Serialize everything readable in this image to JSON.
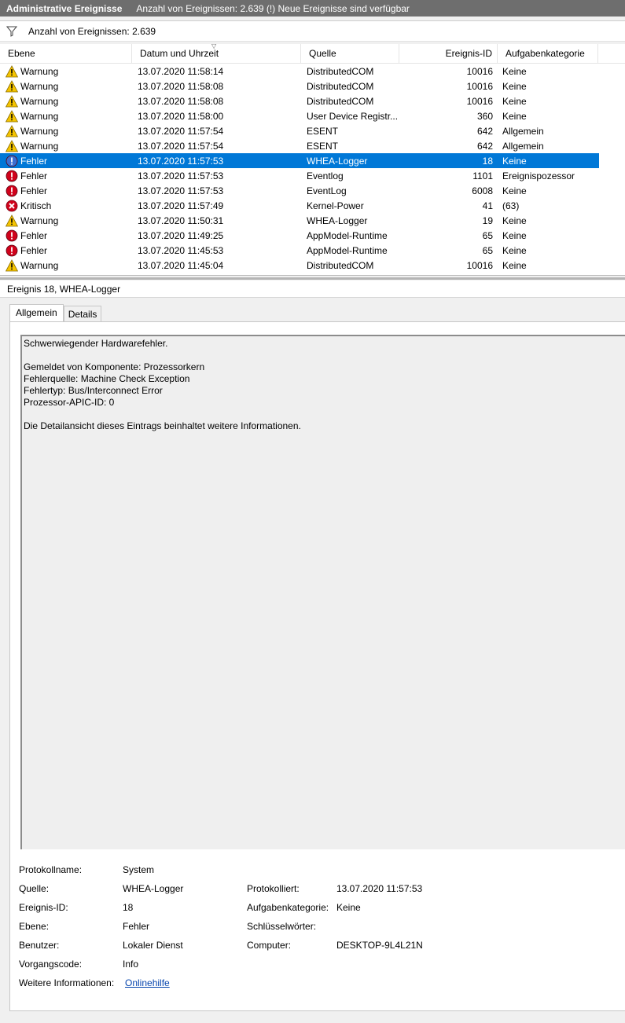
{
  "titlebar": {
    "app": "Administrative Ereignisse",
    "info": "Anzahl von Ereignissen: 2.639 (!) Neue Ereignisse sind verfügbar"
  },
  "filter": {
    "text": "Anzahl von Ereignissen: 2.639",
    "icon": "filter-icon"
  },
  "columns": [
    "Ebene",
    "Datum und Uhrzeit",
    "Quelle",
    "Ereignis-ID",
    "Aufgabenkategorie"
  ],
  "events": [
    {
      "level": "Warnung",
      "icon": "warning",
      "date": "13.07.2020 11:58:14",
      "source": "DistributedCOM",
      "id": "10016",
      "category": "Keine"
    },
    {
      "level": "Warnung",
      "icon": "warning",
      "date": "13.07.2020 11:58:08",
      "source": "DistributedCOM",
      "id": "10016",
      "category": "Keine"
    },
    {
      "level": "Warnung",
      "icon": "warning",
      "date": "13.07.2020 11:58:08",
      "source": "DistributedCOM",
      "id": "10016",
      "category": "Keine"
    },
    {
      "level": "Warnung",
      "icon": "warning",
      "date": "13.07.2020 11:58:00",
      "source": "User Device Registr...",
      "id": "360",
      "category": "Keine"
    },
    {
      "level": "Warnung",
      "icon": "warning",
      "date": "13.07.2020 11:57:54",
      "source": "ESENT",
      "id": "642",
      "category": "Allgemein"
    },
    {
      "level": "Warnung",
      "icon": "warning",
      "date": "13.07.2020 11:57:54",
      "source": "ESENT",
      "id": "642",
      "category": "Allgemein"
    },
    {
      "level": "Fehler",
      "icon": "error",
      "date": "13.07.2020 11:57:53",
      "source": "WHEA-Logger",
      "id": "18",
      "category": "Keine",
      "selected": true
    },
    {
      "level": "Fehler",
      "icon": "error",
      "date": "13.07.2020 11:57:53",
      "source": "Eventlog",
      "id": "1101",
      "category": "Ereignispozessor"
    },
    {
      "level": "Fehler",
      "icon": "error",
      "date": "13.07.2020 11:57:53",
      "source": "EventLog",
      "id": "6008",
      "category": "Keine"
    },
    {
      "level": "Kritisch",
      "icon": "critical",
      "date": "13.07.2020 11:57:49",
      "source": "Kernel-Power",
      "id": "41",
      "category": "(63)"
    },
    {
      "level": "Warnung",
      "icon": "warning",
      "date": "13.07.2020 11:50:31",
      "source": "WHEA-Logger",
      "id": "19",
      "category": "Keine"
    },
    {
      "level": "Fehler",
      "icon": "error",
      "date": "13.07.2020 11:49:25",
      "source": "AppModel-Runtime",
      "id": "65",
      "category": "Keine"
    },
    {
      "level": "Fehler",
      "icon": "error",
      "date": "13.07.2020 11:45:53",
      "source": "AppModel-Runtime",
      "id": "65",
      "category": "Keine"
    },
    {
      "level": "Warnung",
      "icon": "warning",
      "date": "13.07.2020 11:45:04",
      "source": "DistributedCOM",
      "id": "10016",
      "category": "Keine"
    }
  ],
  "detail": {
    "title": "Ereignis 18, WHEA-Logger",
    "tabs": [
      "Allgemein",
      "Details"
    ],
    "message": [
      "Schwerwiegender Hardwarefehler.",
      "",
      "Gemeldet von Komponente: Prozessorkern",
      "Fehlerquelle: Machine Check Exception",
      "Fehlertyp: Bus/Interconnect Error",
      "Prozessor-APIC-ID: 0",
      "",
      "Die Detailansicht dieses Eintrags beinhaltet weitere Informationen."
    ],
    "props": {
      "protokollname_label": "Protokollname:",
      "protokollname": "System",
      "quelle_label": "Quelle:",
      "quelle": "WHEA-Logger",
      "protokolliert_label": "Protokolliert:",
      "protokolliert": "13.07.2020 11:57:53",
      "ereignisid_label": "Ereignis-ID:",
      "ereignisid": "18",
      "aufgabe_label": "Aufgabenkategorie:",
      "aufgabe": "Keine",
      "ebene_label": "Ebene:",
      "ebene": "Fehler",
      "schluessel_label": "Schlüsselwörter:",
      "benutzer_label": "Benutzer:",
      "benutzer": "Lokaler Dienst",
      "computer_label": "Computer:",
      "computer": "DESKTOP-9L4L21N",
      "vorgang_label": "Vorgangscode:",
      "vorgang": "Info",
      "weitere_label": "Weitere Informationen:",
      "weitere_link": "Onlinehilfe"
    }
  },
  "colors": {
    "selection": "#0078d7",
    "titlebar": "#6e6e6e",
    "warning": "#f5c400",
    "error": "#d0021b",
    "info_selected": "#3b6fd1"
  }
}
